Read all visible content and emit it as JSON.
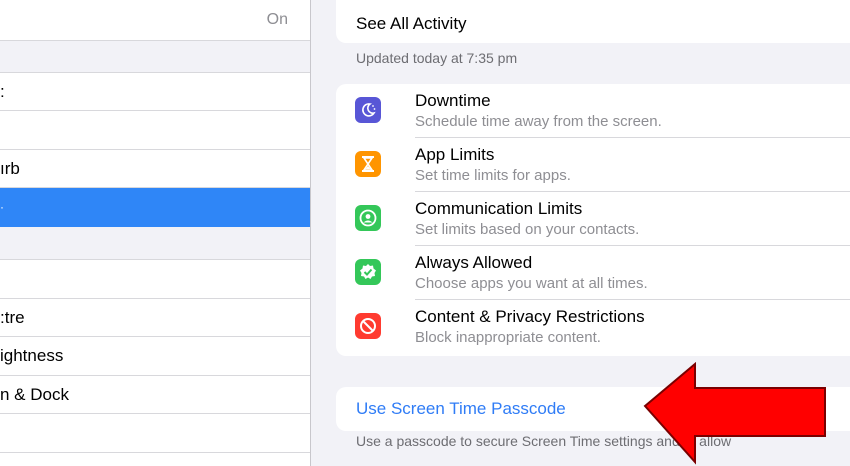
{
  "sidebar": {
    "rows": [
      {
        "text": "",
        "value": "On"
      },
      {
        "text": ":",
        "value": ""
      },
      {
        "text": "",
        "value": ""
      },
      {
        "text": "ırb",
        "value": ""
      },
      {
        "text": ":tre",
        "value": ""
      },
      {
        "text": "ightness",
        "value": ""
      },
      {
        "text": "n & Dock",
        "value": ""
      }
    ],
    "selected_color": "#2f86f7"
  },
  "main": {
    "activity_label": "See All Activity",
    "updated": "Updated today at 7:35 pm",
    "features": [
      {
        "title": "Downtime",
        "subtitle": "Schedule time away from the screen.",
        "icon": "downtime-icon",
        "color": "#5856d6"
      },
      {
        "title": "App Limits",
        "subtitle": "Set time limits for apps.",
        "icon": "hourglass-icon",
        "color": "#ff9500"
      },
      {
        "title": "Communication Limits",
        "subtitle": "Set limits based on your contacts.",
        "icon": "contact-icon",
        "color": "#34c759"
      },
      {
        "title": "Always Allowed",
        "subtitle": "Choose apps you want at all times.",
        "icon": "checkmark-badge-icon",
        "color": "#34c759"
      },
      {
        "title": "Content & Privacy Restrictions",
        "subtitle": "Block inappropriate content.",
        "icon": "no-entry-icon",
        "color": "#ff3b30"
      }
    ],
    "passcode_link": "Use Screen Time Passcode",
    "footer": "Use a passcode to secure Screen Time settings and to allow"
  },
  "annotation": {
    "arrow_color": "#ff0000"
  }
}
